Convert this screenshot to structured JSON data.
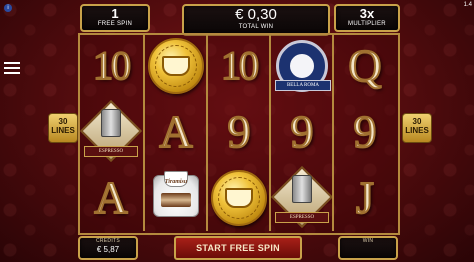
{
  "header": {
    "free_spins_count": "1",
    "free_spins_label": "FREE SPIN",
    "total_win_value": "€ 0,30",
    "total_win_label": "TOTAL WIN",
    "multiplier_value": "3x",
    "multiplier_label": "MULTIPLIER"
  },
  "lines": {
    "left_count": "30",
    "left_label": "LINES",
    "right_count": "30",
    "right_label": "LINES"
  },
  "reels": [
    [
      "10",
      "espresso",
      "A"
    ],
    [
      "scatter",
      "A",
      "tiramisu"
    ],
    [
      "10",
      "9",
      "scatter"
    ],
    [
      "bella-roma",
      "9",
      "espresso"
    ],
    [
      "Q",
      "9",
      "J"
    ]
  ],
  "symbols": {
    "scatter_text": "SCATTER",
    "bella_roma_text": "BELLA ROMA",
    "espresso_text": "ESPRESSO",
    "tiramisu_text": "Tiramisu"
  },
  "footer": {
    "credits_label": "CREDITS",
    "credits_value": "€ 5,87",
    "start_button_label": "START FREE SPIN",
    "win_label": "WIN",
    "win_value": ""
  },
  "misc": {
    "version": "1.4",
    "info_icon": "i"
  },
  "colors": {
    "accent_gold": "#c9a24a",
    "background_red": "#7a1418",
    "button_red": "#a82018"
  }
}
